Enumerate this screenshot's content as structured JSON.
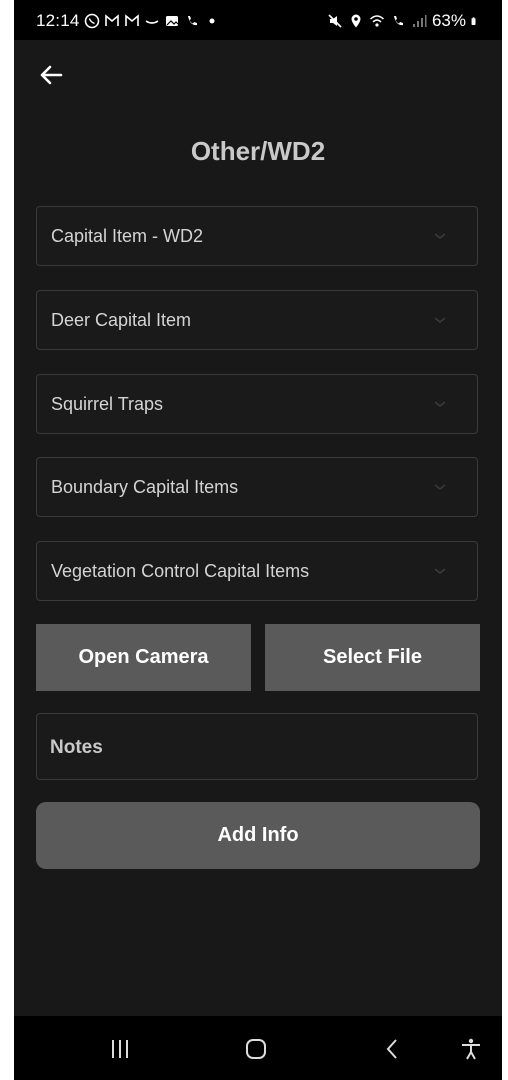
{
  "status_bar": {
    "time": "12:14",
    "battery": "63%"
  },
  "header": {
    "title": "Other/WD2"
  },
  "dropdowns": [
    {
      "label": "Capital Item - WD2"
    },
    {
      "label": "Deer Capital Item"
    },
    {
      "label": "Squirrel Traps"
    },
    {
      "label": "Boundary Capital Items"
    },
    {
      "label": "Vegetation Control Capital Items"
    }
  ],
  "actions": {
    "open_camera": "Open Camera",
    "select_file": "Select File"
  },
  "notes": {
    "label": "Notes"
  },
  "submit": {
    "label": "Add Info"
  },
  "colors": {
    "background": "#181818",
    "button": "#5a5a5a",
    "border": "#3a3a3a"
  }
}
